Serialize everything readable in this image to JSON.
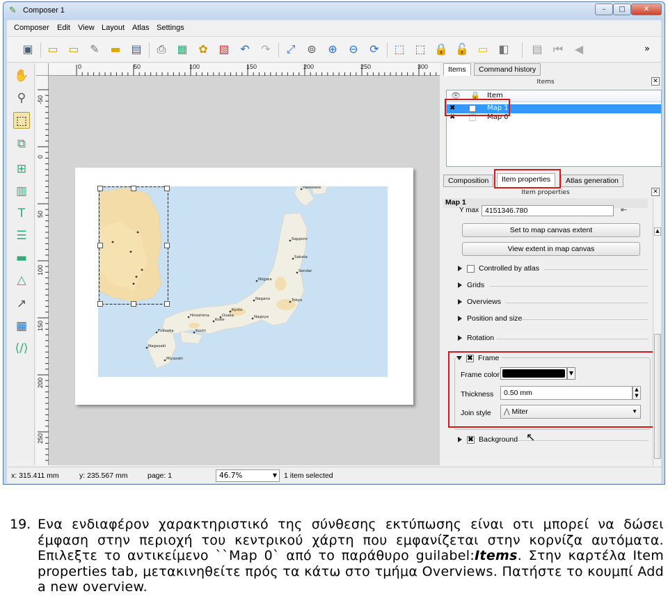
{
  "window": {
    "title": "Composer 1",
    "min": "–",
    "max": "□",
    "close": "✕"
  },
  "menu": [
    "Composer",
    "Edit",
    "View",
    "Layout",
    "Atlas",
    "Settings"
  ],
  "toolbar": {
    "overflow": "»"
  },
  "rulers": {
    "h": [
      "0",
      "50",
      "100",
      "150",
      "200",
      "250",
      "300"
    ],
    "v": [
      "-50",
      "0",
      "50",
      "100",
      "150",
      "200",
      "250"
    ]
  },
  "map_labels": [
    "Hakodate",
    "Sapporo",
    "Sakata",
    "Sendai",
    "Niigata",
    "Nagano",
    "Kyoto",
    "Osaka",
    "Kobe",
    "Nagoya",
    "Hiroshima",
    "Kochi",
    "Fukuoka",
    "Nagasaki",
    "Miyazaki",
    "Tokyo"
  ],
  "items_panel": {
    "tabs": [
      "Items",
      "Command history"
    ],
    "header": "Items",
    "columns": {
      "item": "Item"
    },
    "rows": [
      {
        "name": "Map 1",
        "selected": true
      },
      {
        "name": "Map 0",
        "selected": false
      }
    ]
  },
  "props_panel": {
    "tabs": [
      "Composition",
      "Item properties",
      "Atlas generation"
    ],
    "header": "Item properties",
    "title": "Map 1",
    "ymax_label": "Y max",
    "ymax_value": "4151346.780",
    "btn_set_extent": "Set to map canvas extent",
    "btn_view_extent": "View extent in map canvas",
    "controlled_by_atlas": "Controlled by atlas",
    "groups": [
      "Grids",
      "Overviews",
      "Position and size",
      "Rotation"
    ],
    "frame": {
      "label": "Frame",
      "color_label": "Frame color",
      "color": "#000000",
      "thickness_label": "Thickness",
      "thickness_value": "0.50 mm",
      "join_label": "Join style",
      "join_value": "Miter"
    },
    "background": "Background"
  },
  "status": {
    "x": "x: 315.411 mm",
    "y": "y: 235.567 mm",
    "page": "page: 1",
    "zoom": "46.7%",
    "selected": "1 item selected"
  },
  "caption": {
    "number": "19.",
    "text_before": "Ενα ενδιαφέρον χαρακτηριστικό της σύνθεσης εκτύπωσης είναι οτι μπορεί να δώσει έμφαση στην περιοχή του κεντρικού χάρτη που εμφανίζεται στην κορνίζα αυτόματα. Επιλεξτε το αντικείμενο ``Map 0` από το παράθυρο guilabel:",
    "text_bold": "Items",
    "text_after": ". Στην καρτέλα Item properties tab, μετακινηθείτε πρός τα κάτω στο τμήμα Overviews. Πατήστε το κουμπί Add a new overview."
  }
}
